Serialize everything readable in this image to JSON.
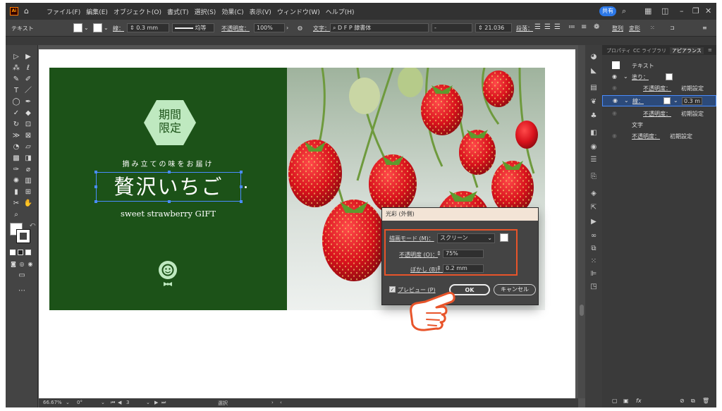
{
  "app": {
    "logo": "Ai",
    "home_icon": "home-icon"
  },
  "menu": [
    "ファイル(F)",
    "編集(E)",
    "オブジェクト(O)",
    "書式(T)",
    "選択(S)",
    "効果(C)",
    "表示(V)",
    "ウィンドウ(W)",
    "ヘルプ(H)"
  ],
  "titlebar": {
    "share": "共有"
  },
  "control": {
    "object_type": "テキスト",
    "stroke_label": "線：",
    "stroke_value": "0.3 mm",
    "profile": "均等",
    "opacity_label": "不透明度：",
    "opacity_value": "100%",
    "char_label": "文字：",
    "font_name": "D F P 隷書体",
    "font_style": "-",
    "font_size": "21.036",
    "para_label": "段落：",
    "align_label": "整列",
    "transform_label": "変形"
  },
  "artwork": {
    "badge_line1": "期間",
    "badge_line2": "限定",
    "subtitle": "摘み立ての味をお届け",
    "title": "贅沢いちご",
    "english": "sweet strawberry GIFT"
  },
  "right_panel": {
    "tabs": [
      "プロパティ",
      "CC ライブラリ",
      "アピアランス"
    ],
    "header": "テキスト",
    "fill_label": "塗り：",
    "opacity_label": "不透明度：",
    "opacity_value": "初期設定",
    "stroke_label": "線：",
    "stroke_value": "0.3 m",
    "char_label": "文字",
    "fx_label": "fx"
  },
  "dialog": {
    "title": "光彩 (外側)",
    "mode_label": "描画モード (M)：",
    "mode_value": "スクリーン",
    "opacity_label": "不透明度 (O)：",
    "opacity_value": "75%",
    "blur_label": "ぼかし (B)：",
    "blur_value": "0.2 mm",
    "preview_label": "プレビュー (P)",
    "ok": "OK",
    "cancel": "キャンセル"
  },
  "status": {
    "zoom": "66.67%",
    "rotate": "0°",
    "artboard": "3",
    "tool": "選択"
  },
  "colors": {
    "panel_green": "#1c5218",
    "badge_mint": "#bfe9c0",
    "accent_red": "#e8542a",
    "share_blue": "#2c78e8"
  }
}
